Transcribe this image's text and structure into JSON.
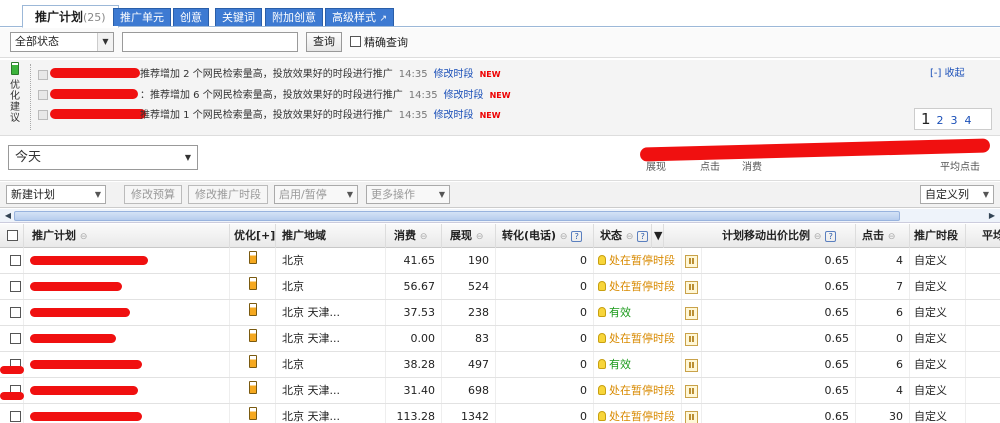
{
  "tabs": [
    {
      "label": "推广计划",
      "count": "(25)",
      "active": true
    },
    {
      "label": "推广单元"
    },
    {
      "label": "创意"
    },
    {
      "label": "关键词"
    },
    {
      "label": "附加创意"
    },
    {
      "label": "高级样式"
    }
  ],
  "filter": {
    "status_value": "全部状态",
    "search_value": "",
    "query_button": "查询",
    "exact_label": "精确查询"
  },
  "suggestions": {
    "side_title": "优化建议",
    "collapse": "[-] 收起",
    "rows": [
      {
        "text": "推荐增加 2 个网民检索量高，投放效果好的时段进行推广",
        "time": "14:35",
        "link": "修改时段",
        "badge": "NEW"
      },
      {
        "text": "：推荐增加 6 个网民检索量高，投放效果好的时段进行推广",
        "time": "14:35",
        "link": "修改时段",
        "badge": "NEW"
      },
      {
        "text": "推荐增加 1 个网民检索量高，投放效果好的时段进行推广",
        "time": "14:35",
        "link": "修改时段",
        "badge": "NEW"
      }
    ],
    "pages": {
      "current": "1",
      "others": [
        "2",
        "3",
        "4"
      ]
    }
  },
  "date": {
    "value": "今天",
    "metric_labels": [
      "展现",
      "点击",
      "消费",
      "平均点击"
    ]
  },
  "toolbar": {
    "new_plan": "新建计划",
    "modify_budget": "修改预算",
    "modify_time": "修改推广时段",
    "enable_pause": "启用/暂停",
    "more_ops": "更多操作",
    "custom_cols": "自定义列"
  },
  "table": {
    "headers": {
      "plan": "推广计划",
      "opt": "优化[+]",
      "region": "推广地域",
      "cost": "消费",
      "impressions": "展现",
      "conversion": "转化(电话)",
      "status": "状态",
      "mobile_ratio": "计划移动出价比例",
      "clicks": "点击",
      "time": "推广时段",
      "avg": "平均"
    },
    "rows": [
      {
        "region": "北京",
        "cost": "41.65",
        "impressions": "190",
        "conversion": "0",
        "status": "处在暂停时段",
        "status_type": "pause",
        "ratio": "0.65",
        "clicks": "4",
        "time": "自定义"
      },
      {
        "region": "北京",
        "cost": "56.67",
        "impressions": "524",
        "conversion": "0",
        "status": "处在暂停时段",
        "status_type": "pause",
        "ratio": "0.65",
        "clicks": "7",
        "time": "自定义"
      },
      {
        "region": "北京 天津...",
        "cost": "37.53",
        "impressions": "238",
        "conversion": "0",
        "status": "有效",
        "status_type": "ok",
        "ratio": "0.65",
        "clicks": "6",
        "time": "自定义"
      },
      {
        "region": "北京 天津...",
        "cost": "0.00",
        "impressions": "83",
        "conversion": "0",
        "status": "处在暂停时段",
        "status_type": "pause",
        "ratio": "0.65",
        "clicks": "0",
        "time": "自定义"
      },
      {
        "region": "北京",
        "cost": "38.28",
        "impressions": "497",
        "conversion": "0",
        "status": "有效",
        "status_type": "ok",
        "ratio": "0.65",
        "clicks": "6",
        "time": "自定义"
      },
      {
        "region": "北京 天津...",
        "cost": "31.40",
        "impressions": "698",
        "conversion": "0",
        "status": "处在暂停时段",
        "status_type": "pause",
        "ratio": "0.65",
        "clicks": "4",
        "time": "自定义"
      },
      {
        "region": "北京 天津...",
        "cost": "113.28",
        "impressions": "1342",
        "conversion": "0",
        "status": "处在暂停时段",
        "status_type": "pause",
        "ratio": "0.65",
        "clicks": "30",
        "time": "自定义"
      }
    ]
  }
}
